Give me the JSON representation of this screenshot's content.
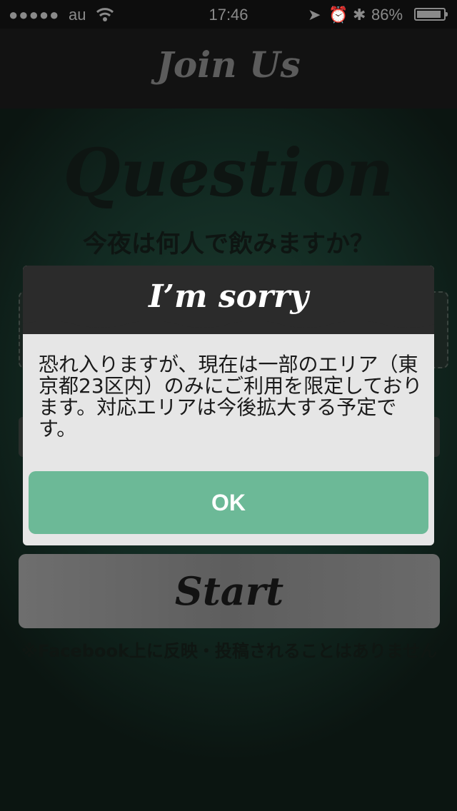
{
  "status_bar": {
    "signal": "●●●●●",
    "carrier": "au",
    "time": "17:46",
    "location_icon": "➤",
    "alarm_icon": "⏰",
    "bluetooth_icon": "✱",
    "battery": "86%"
  },
  "nav": {
    "title": "Join Us"
  },
  "main": {
    "question_title": "Question",
    "question_text": "今夜は何人で飲みますか？",
    "start_label": "Start",
    "footnote": "※Facebook上に反映・投稿されることはありません"
  },
  "dialog": {
    "title": "I’m sorry",
    "message": "恐れ入りますが、現在は一部のエリア（東京都23区内）のみにご利用を限定しております。対応エリアは今後拡大する予定です。",
    "ok_label": "OK"
  },
  "colors": {
    "accent": "#6cb997",
    "dialog_header": "#2b2b2b",
    "background": "#122a22"
  }
}
